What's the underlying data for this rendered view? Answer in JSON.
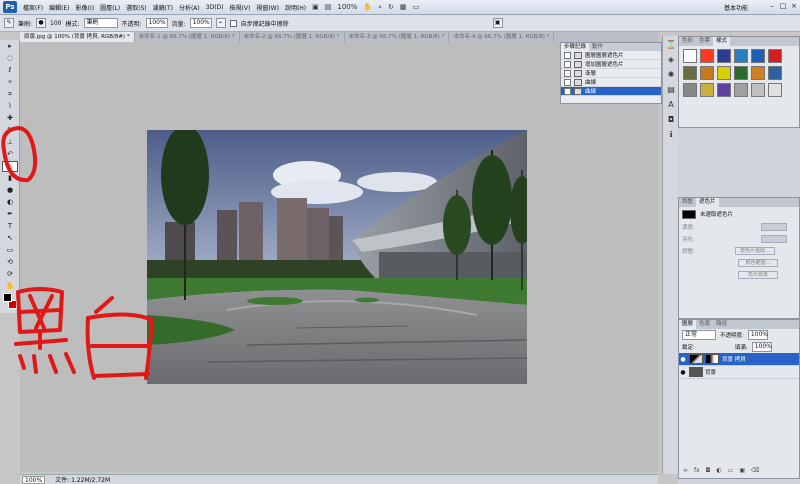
{
  "menubar": {
    "logo": "Ps",
    "items": [
      "檔案(F)",
      "編輯(E)",
      "影像(I)",
      "圖層(L)",
      "選取(S)",
      "濾鏡(T)",
      "分析(A)",
      "3D(D)",
      "檢視(V)",
      "視窗(W)",
      "說明(H)"
    ],
    "zoom": "100%",
    "workspace": "基本功能",
    "win_minimize": "–",
    "win_restore": "□",
    "win_close": "×"
  },
  "options": {
    "mode_label": "模式:",
    "mode_value": "筆刷",
    "brush_label": "筆刷:",
    "brush_size": "100",
    "opacity_label": "不透明:",
    "opacity_value": "100%",
    "flow_label": "流量:",
    "flow_value": "100%",
    "erase_history_label": "自步擦記錄中擦除"
  },
  "doc_tabs": [
    "原版.jpg @ 100% (背景 拷貝, RGB/8#) *",
    "未命名-1 @ 66.7% (圖層 1, RGB/8) *",
    "未命名-2 @ 66.7% (圖層 1, RGB/8) *",
    "未命名-3 @ 66.7% (圖層 1, RGB/8) *",
    "未命名-4 @ 66.7% (圖層 1, RGB/8) *"
  ],
  "status": {
    "zoom": "100%",
    "doc_size": "文件: 1.22M/2.72M"
  },
  "history": {
    "tabs": [
      "步驟記錄",
      "動作"
    ],
    "rows": [
      {
        "label": "圖層圖層遮色片",
        "active": false
      },
      {
        "label": "增加圖層遮色片",
        "active": false
      },
      {
        "label": "漸層",
        "active": false
      },
      {
        "label": "曲線",
        "active": false
      },
      {
        "label": "曲線",
        "active": true
      }
    ]
  },
  "styles_panel": {
    "tabs": [
      "色彩",
      "色票",
      "樣式"
    ],
    "swatch_colors": [
      "#ffffff",
      "#ff3b1f",
      "#2a3f8f",
      "#2b7fc0",
      "#1f5fb0",
      "#d02020",
      "#6b6b40",
      "#c47a20",
      "#d6d000",
      "#2c6b2c",
      "#d08020",
      "#3060a0",
      "#888888",
      "#c8b040",
      "#6040a0",
      "#a0a0a0",
      "#c0c0c0",
      "#e0e0e0"
    ]
  },
  "adjustments": {
    "tabs": [
      "調整",
      "遮色片"
    ],
    "title": "未選取遮色片",
    "density_label": "濃度:",
    "feather_label": "羽化:",
    "refine_label": "調整:",
    "btn_mask_edge": "遮色片邊緣...",
    "btn_color_range": "顏色範圍...",
    "btn_invert": "負片效果"
  },
  "layers": {
    "tabs": [
      "圖層",
      "色版",
      "路徑"
    ],
    "blend_mode": "正常",
    "opacity_label": "不透明度:",
    "opacity_value": "100%",
    "lock_label": "鎖定:",
    "fill_label": "填滿:",
    "fill_value": "100%",
    "rows": [
      {
        "name": "背景 拷貝",
        "active": true,
        "mask": true
      },
      {
        "name": "背景",
        "active": false,
        "mask": false
      }
    ]
  },
  "annotation": {
    "color": "#e01818",
    "text": "黑白"
  }
}
